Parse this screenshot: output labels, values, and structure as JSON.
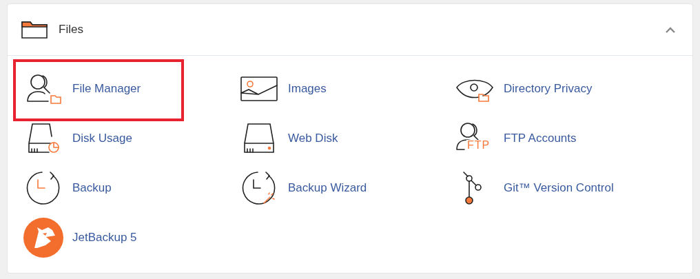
{
  "section": {
    "title": "Files",
    "expanded": true
  },
  "items": [
    {
      "kind": "file-manager",
      "label": "File Manager",
      "highlighted": true
    },
    {
      "kind": "images",
      "label": "Images",
      "highlighted": false
    },
    {
      "kind": "directory-privacy",
      "label": "Directory Privacy",
      "highlighted": false
    },
    {
      "kind": "disk-usage",
      "label": "Disk Usage",
      "highlighted": false
    },
    {
      "kind": "web-disk",
      "label": "Web Disk",
      "highlighted": false
    },
    {
      "kind": "ftp",
      "label": "FTP Accounts",
      "icon_text": "FTP",
      "highlighted": false
    },
    {
      "kind": "backup",
      "label": "Backup",
      "highlighted": false
    },
    {
      "kind": "backup-wizard",
      "label": "Backup Wizard",
      "highlighted": false
    },
    {
      "kind": "git",
      "label": "Git™ Version Control",
      "highlighted": false
    },
    {
      "kind": "jetbackup",
      "label": "JetBackup 5",
      "highlighted": false
    }
  ]
}
